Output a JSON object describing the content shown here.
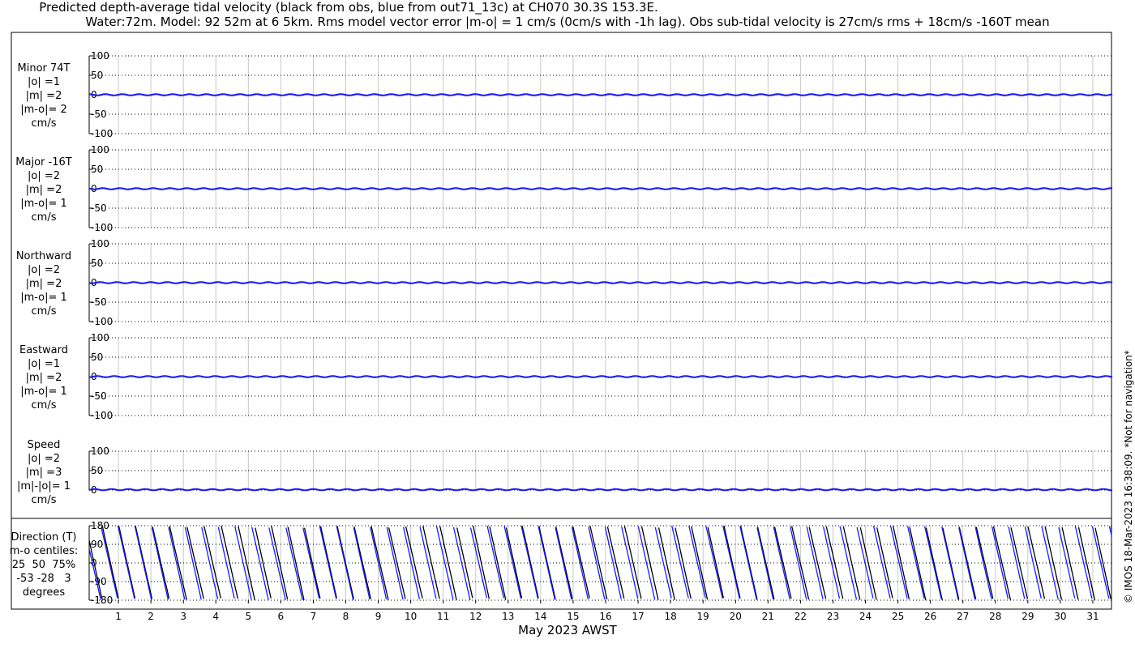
{
  "title_line1": "Predicted depth-average tidal velocity (black from obs, blue from out71_13c) at CH070 30.3S 153.3E.",
  "title_line2": "Water:72m. Model: 92 52m at 6 5km. Rms model vector error |m-o| = 1 cm/s (0cm/s with -1h lag). Obs sub-tidal velocity is 27cm/s rms + 18cm/s -160T mean",
  "copyright": "© IMOS 18-Mar-2023 16:38:09. *Not for navigation*",
  "panels": [
    {
      "id": "minor",
      "label_lines": [
        "Minor 74T",
        "|o| =1",
        "|m| =2",
        "|m-o|= 2",
        "cm/s"
      ]
    },
    {
      "id": "major",
      "label_lines": [
        "Major -16T",
        "|o| =2",
        "|m| =2",
        "|m-o|= 1",
        "cm/s"
      ]
    },
    {
      "id": "north",
      "label_lines": [
        "Northward",
        "|o| =2",
        "|m| =2",
        "|m-o|= 1",
        "cm/s"
      ]
    },
    {
      "id": "east",
      "label_lines": [
        "Eastward",
        "|o| =1",
        "|m| =2",
        "|m-o|= 1",
        "cm/s"
      ]
    },
    {
      "id": "speed",
      "label_lines": [
        "Speed",
        "|o| =2",
        "|m| =3",
        "|m|-|o|= 1",
        "cm/s"
      ]
    },
    {
      "id": "direction",
      "label_lines": [
        "Direction (T)",
        "m-o centiles:",
        "25  50  75%",
        "-53 -28   3",
        "degrees"
      ]
    }
  ],
  "chart_data": {
    "type": "line",
    "xlabel": "May 2023 AWST",
    "x_ticks": [
      "1",
      "2",
      "3",
      "4",
      "5",
      "6",
      "7",
      "8",
      "9",
      "10",
      "11",
      "12",
      "13",
      "14",
      "15",
      "16",
      "17",
      "18",
      "19",
      "20",
      "21",
      "22",
      "23",
      "24",
      "25",
      "26",
      "27",
      "28",
      "29",
      "30",
      "31"
    ],
    "xlim_days": [
      0.1,
      31.6
    ],
    "velocity_yticks": [
      "100",
      "50",
      "0",
      "-50",
      "-100"
    ],
    "velocity_ylim": [
      -100,
      100
    ],
    "speed_yticks": [
      "100",
      "50",
      "0"
    ],
    "speed_ylim": [
      0,
      100
    ],
    "direction_yticks": [
      "180",
      "90",
      "0",
      "-90",
      "-180"
    ],
    "direction_ylim": [
      -180,
      180
    ],
    "series": [
      {
        "name": "obs",
        "color": "#000000"
      },
      {
        "name": "model",
        "color": "#1a1aff"
      }
    ],
    "grid": true,
    "velocity_amplitude_cm_s": {
      "minor": 2,
      "major": 2,
      "north": 2,
      "east": 2,
      "speed": 2
    }
  }
}
